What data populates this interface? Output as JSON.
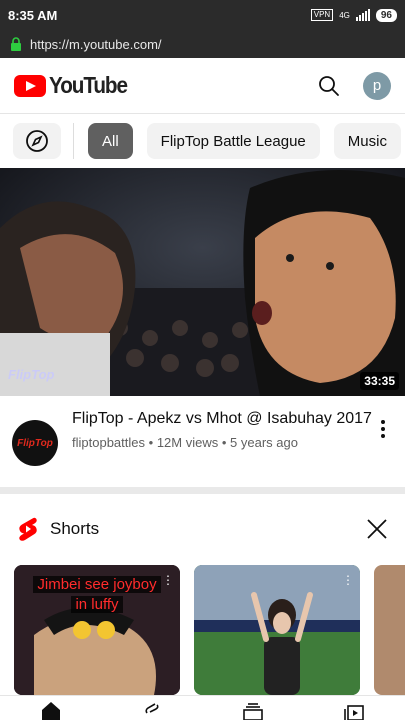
{
  "status_bar": {
    "time": "8:35 AM",
    "vpn": "VPN",
    "network": "4G",
    "battery": "96"
  },
  "browser": {
    "url": "https://m.youtube.com/"
  },
  "header": {
    "logo_text": "YouTube",
    "avatar_letter": "p"
  },
  "chips": {
    "items": [
      "All",
      "FlipTop Battle League",
      "Music"
    ]
  },
  "video": {
    "duration": "33:35",
    "watermark": "FlipTop",
    "title": "FlipTop - Apekz vs Mhot @ Isabuhay 2017",
    "channel": "fliptopbattles",
    "views": "12M views",
    "age": "5 years ago",
    "meta_separator": "•",
    "channel_avatar_text": "FlipTop"
  },
  "shorts": {
    "title": "Shorts",
    "items": [
      {
        "caption_line1": "Jimbei see joyboy",
        "caption_line2": "in luffy"
      },
      {
        "caption_line1": "",
        "caption_line2": ""
      },
      {
        "caption_line1": "",
        "caption_line2": ""
      }
    ]
  },
  "colors": {
    "brand_red": "#ff0000",
    "active_chip": "#606060",
    "status_bar": "#2b2b2b"
  }
}
